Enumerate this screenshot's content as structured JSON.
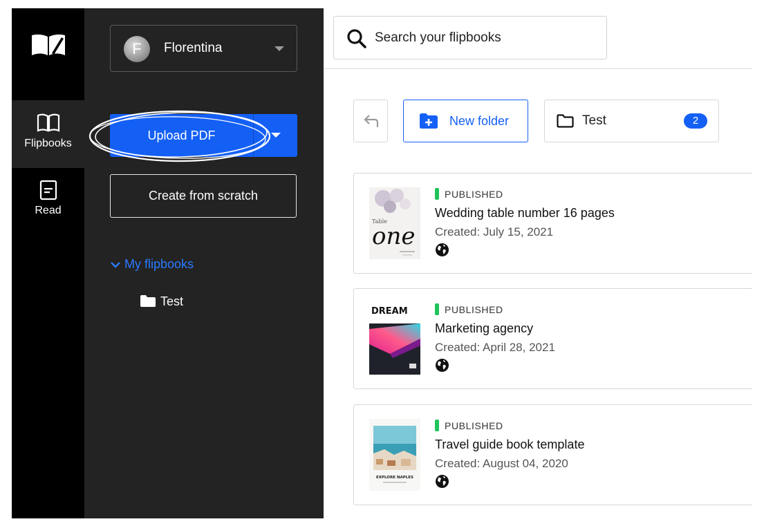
{
  "rail": {
    "items": [
      {
        "label": "Flipbooks",
        "active": true
      },
      {
        "label": "Read",
        "active": false
      }
    ]
  },
  "account": {
    "initial": "F",
    "name": "Florentina"
  },
  "panel": {
    "upload_label": "Upload PDF",
    "scratch_label": "Create from scratch",
    "tree": {
      "root_label": "My flipbooks",
      "folders": [
        "Test"
      ]
    }
  },
  "search": {
    "placeholder": "Search your flipbooks"
  },
  "toolbar": {
    "new_folder_label": "New folder",
    "folder": {
      "name": "Test",
      "count": "2"
    }
  },
  "flipbooks": [
    {
      "status": "PUBLISHED",
      "title": "Wedding table number 16 pages",
      "created": "Created: July 15, 2021",
      "cover_text": "one",
      "cover_small": "Table"
    },
    {
      "status": "PUBLISHED",
      "title": "Marketing agency",
      "created": "Created: April 28, 2021",
      "cover_text": "DREAM"
    },
    {
      "status": "PUBLISHED",
      "title": "Travel guide book template",
      "created": "Created: August 04, 2020",
      "cover_text": "EXPLORE NAPLES"
    }
  ],
  "colors": {
    "accent": "#1460f5",
    "published": "#1fc35a",
    "rail_bg": "#000000",
    "panel_bg": "#232323",
    "tree_link": "#2a7bff"
  },
  "icons": {
    "logo": "open-book-pen-icon",
    "rail_flipbooks": "open-book-icon",
    "rail_read": "document-icon",
    "search": "search-icon",
    "back": "back-arrow-icon",
    "new_folder": "folder-plus-icon",
    "folder": "folder-icon",
    "visibility": "globe-icon"
  }
}
